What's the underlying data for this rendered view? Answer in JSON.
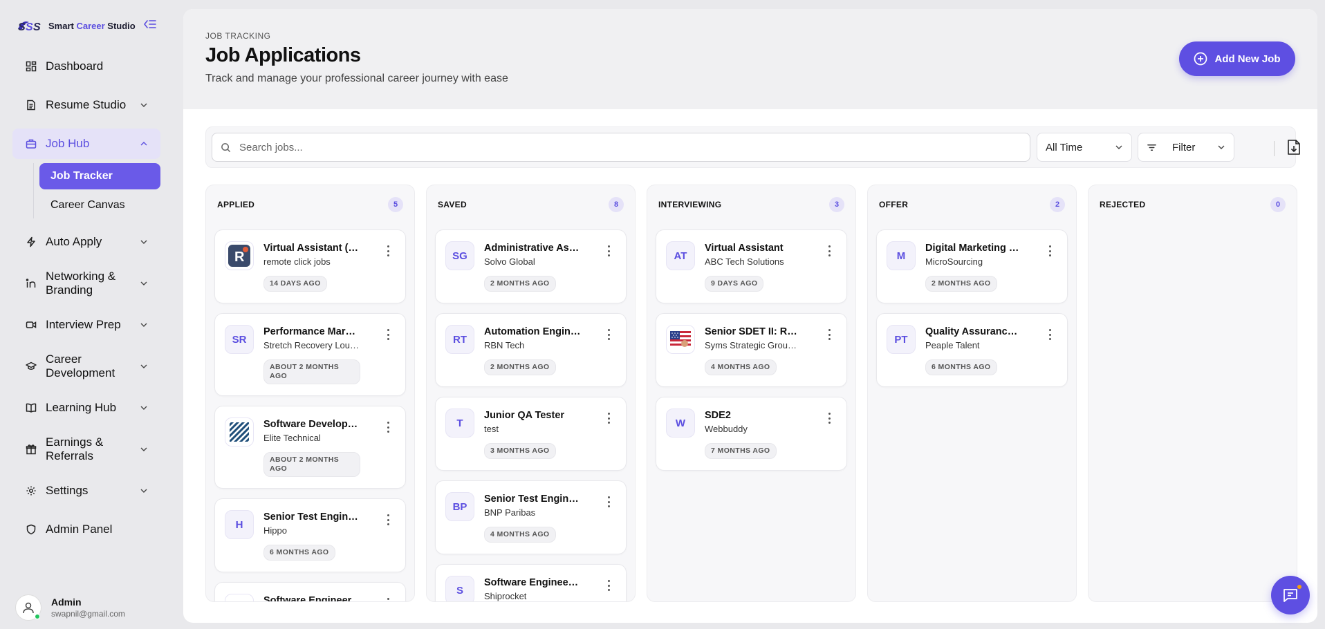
{
  "brand": {
    "part1": "Smart ",
    "part2": "Career",
    "part3": " Studio"
  },
  "sidebar": {
    "items": [
      {
        "label": "Dashboard",
        "icon": "grid-icon"
      },
      {
        "label": "Resume Studio",
        "icon": "document-icon"
      },
      {
        "label": "Job Hub",
        "icon": "briefcase-icon"
      },
      {
        "label": "Auto Apply",
        "icon": "bolt-icon"
      },
      {
        "label": "Networking & Branding",
        "icon": "linkedin-icon"
      },
      {
        "label": "Interview Prep",
        "icon": "video-icon"
      },
      {
        "label": "Career Development",
        "icon": "graduation-cap-icon"
      },
      {
        "label": "Learning Hub",
        "icon": "book-icon"
      },
      {
        "label": "Earnings & Referrals",
        "icon": "gift-icon"
      },
      {
        "label": "Settings",
        "icon": "gear-icon"
      },
      {
        "label": "Admin Panel",
        "icon": "shield-icon"
      }
    ],
    "sub_items": [
      {
        "label": "Job Tracker"
      },
      {
        "label": "Career Canvas"
      }
    ]
  },
  "user": {
    "name": "Admin",
    "email": "swapnil@gmail.com"
  },
  "header": {
    "eyebrow": "JOB TRACKING",
    "title": "Job Applications",
    "subtitle": "Track and manage your professional career journey with ease",
    "add_button": "Add New Job"
  },
  "toolbar": {
    "search_placeholder": "Search jobs...",
    "time_filter": "All Time",
    "filter_label": "Filter"
  },
  "columns": [
    {
      "title": "APPLIED",
      "count": "5",
      "cards": [
        {
          "title": "Virtual Assistant (Full-Time)",
          "company": "remote click jobs",
          "time": "14 DAYS AGO",
          "initials": "",
          "logo": "r-logo"
        },
        {
          "title": "Performance Marketing Manager",
          "company": "Stretch Recovery Lounge",
          "time": "ABOUT 2 MONTHS AGO",
          "initials": "SR"
        },
        {
          "title": "Software Development Engineer",
          "company": "Elite Technical",
          "time": "ABOUT 2 MONTHS AGO",
          "initials": "",
          "logo": "stripes-logo"
        },
        {
          "title": "Senior Test Engineer",
          "company": "Hippo",
          "time": "6 MONTHS AGO",
          "initials": "H"
        },
        {
          "title": "Software Engineer",
          "company": "",
          "time": "",
          "initials": "",
          "logo": "bar-logo"
        }
      ]
    },
    {
      "title": "SAVED",
      "count": "8",
      "cards": [
        {
          "title": "Administrative Assistant",
          "company": "Solvo Global",
          "time": "2 MONTHS AGO",
          "initials": "SG"
        },
        {
          "title": "Automation Engineer",
          "company": "RBN Tech",
          "time": "2 MONTHS AGO",
          "initials": "RT"
        },
        {
          "title": "Junior QA Tester",
          "company": "test",
          "time": "3 MONTHS AGO",
          "initials": "T"
        },
        {
          "title": "Senior Test Engineer",
          "company": "BNP Paribas",
          "time": "4 MONTHS AGO",
          "initials": "BP"
        },
        {
          "title": "Software Engineer / Developer",
          "company": "Shiprocket",
          "time": "",
          "initials": "S"
        }
      ]
    },
    {
      "title": "INTERVIEWING",
      "count": "3",
      "cards": [
        {
          "title": "Virtual Assistant",
          "company": "ABC Tech Solutions",
          "time": "9 DAYS AGO",
          "initials": "AT"
        },
        {
          "title": "Senior SDET II: Remote",
          "company": "Syms Strategic Group, LLC",
          "time": "4 MONTHS AGO",
          "initials": "",
          "logo": "flag-logo"
        },
        {
          "title": "SDE2",
          "company": "Webbuddy",
          "time": "7 MONTHS AGO",
          "initials": "W"
        }
      ]
    },
    {
      "title": "OFFER",
      "count": "2",
      "cards": [
        {
          "title": "Digital Marketing & SEO",
          "company": "MicroSourcing",
          "time": "2 MONTHS AGO",
          "initials": "M"
        },
        {
          "title": "Quality Assurance Analyst",
          "company": "Peaple Talent",
          "time": "6 MONTHS AGO",
          "initials": "PT"
        }
      ]
    },
    {
      "title": "REJECTED",
      "count": "0",
      "cards": []
    }
  ],
  "colors": {
    "accent": "#5e4fe2",
    "accent_light": "#e5e2f8"
  }
}
